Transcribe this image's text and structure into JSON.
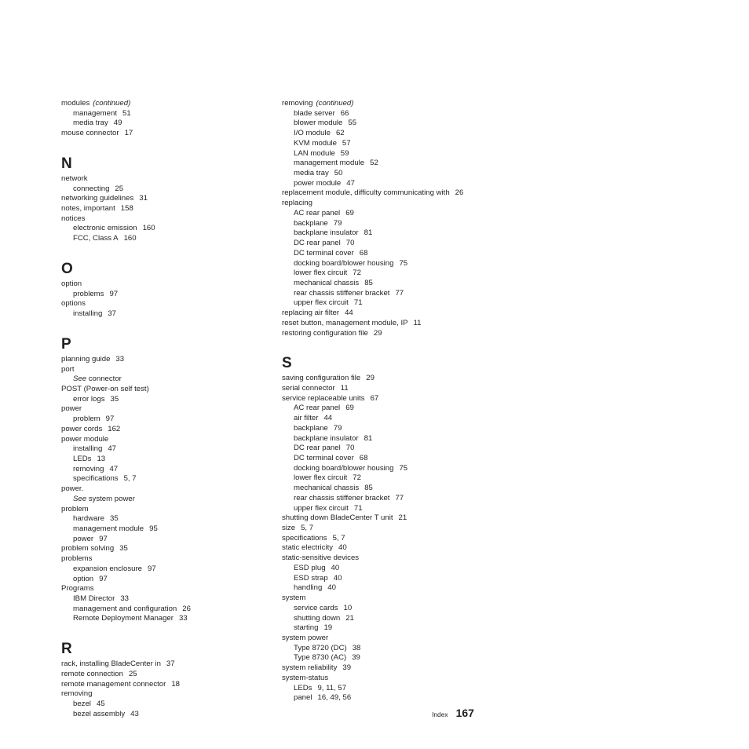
{
  "document": {
    "page_type": "index",
    "footer_label": "Index",
    "footer_page_number": "167",
    "text_color": "#231f20",
    "background_color": "#ffffff"
  },
  "columns": [
    {
      "name": "left-column",
      "sections": [
        {
          "letter": "",
          "entries": [
            {
              "level": 0,
              "term": "modules",
              "continued": "(continued)",
              "pages": ""
            },
            {
              "level": 1,
              "term": "management",
              "pages": "51"
            },
            {
              "level": 1,
              "term": "media tray",
              "pages": "49"
            },
            {
              "level": 0,
              "term": "mouse connector",
              "pages": "17"
            }
          ]
        },
        {
          "letter": "N",
          "entries": [
            {
              "level": 0,
              "term": "network",
              "pages": ""
            },
            {
              "level": 1,
              "term": "connecting",
              "pages": "25"
            },
            {
              "level": 0,
              "term": "networking guidelines",
              "pages": "31"
            },
            {
              "level": 0,
              "term": "notes, important",
              "pages": "158"
            },
            {
              "level": 0,
              "term": "notices",
              "pages": ""
            },
            {
              "level": 1,
              "term": "electronic emission",
              "pages": "160"
            },
            {
              "level": 1,
              "term": "FCC, Class A",
              "pages": "160"
            }
          ]
        },
        {
          "letter": "O",
          "entries": [
            {
              "level": 0,
              "term": "option",
              "pages": ""
            },
            {
              "level": 1,
              "term": "problems",
              "pages": "97"
            },
            {
              "level": 0,
              "term": "options",
              "pages": ""
            },
            {
              "level": 1,
              "term": "installing",
              "pages": "37"
            }
          ]
        },
        {
          "letter": "P",
          "entries": [
            {
              "level": 0,
              "term": "planning guide",
              "pages": "33"
            },
            {
              "level": 0,
              "term": "port",
              "pages": ""
            },
            {
              "level": 1,
              "see": "See",
              "term": "connector",
              "pages": ""
            },
            {
              "level": 0,
              "term": "POST (Power-on self test)",
              "pages": ""
            },
            {
              "level": 1,
              "term": "error logs",
              "pages": "35"
            },
            {
              "level": 0,
              "term": "power",
              "pages": ""
            },
            {
              "level": 1,
              "term": "problem",
              "pages": "97"
            },
            {
              "level": 0,
              "term": "power cords",
              "pages": "162"
            },
            {
              "level": 0,
              "term": "power module",
              "pages": ""
            },
            {
              "level": 1,
              "term": "installing",
              "pages": "47"
            },
            {
              "level": 1,
              "term": "LEDs",
              "pages": "13"
            },
            {
              "level": 1,
              "term": "removing",
              "pages": "47"
            },
            {
              "level": 1,
              "term": "specifications",
              "pages": "5, 7"
            },
            {
              "level": 0,
              "term": "power.",
              "pages": ""
            },
            {
              "level": 1,
              "see": "See",
              "term": "system power",
              "pages": ""
            },
            {
              "level": 0,
              "term": "problem",
              "pages": ""
            },
            {
              "level": 1,
              "term": "hardware",
              "pages": "35"
            },
            {
              "level": 1,
              "term": "management module",
              "pages": "95"
            },
            {
              "level": 1,
              "term": "power",
              "pages": "97"
            },
            {
              "level": 0,
              "term": "problem solving",
              "pages": "35"
            },
            {
              "level": 0,
              "term": "problems",
              "pages": ""
            },
            {
              "level": 1,
              "term": "expansion enclosure",
              "pages": "97"
            },
            {
              "level": 1,
              "term": "option",
              "pages": "97"
            },
            {
              "level": 0,
              "term": "Programs",
              "pages": ""
            },
            {
              "level": 1,
              "term": "IBM Director",
              "pages": "33"
            },
            {
              "level": 1,
              "term": "management and configuration",
              "pages": "26"
            },
            {
              "level": 1,
              "term": "Remote Deployment Manager",
              "pages": "33"
            }
          ]
        },
        {
          "letter": "R",
          "entries": [
            {
              "level": 0,
              "term": "rack, installing BladeCenter in",
              "pages": "37"
            },
            {
              "level": 0,
              "term": "remote connection",
              "pages": "25"
            },
            {
              "level": 0,
              "term": "remote management connector",
              "pages": "18"
            },
            {
              "level": 0,
              "term": "removing",
              "pages": ""
            },
            {
              "level": 1,
              "term": "bezel",
              "pages": "45"
            },
            {
              "level": 1,
              "term": "bezel assembly",
              "pages": "43"
            }
          ]
        }
      ]
    },
    {
      "name": "right-column",
      "sections": [
        {
          "letter": "",
          "entries": [
            {
              "level": 0,
              "term": "removing",
              "continued": "(continued)",
              "pages": ""
            },
            {
              "level": 1,
              "term": "blade server",
              "pages": "66"
            },
            {
              "level": 1,
              "term": "blower module",
              "pages": "55"
            },
            {
              "level": 1,
              "term": "I/O module",
              "pages": "62"
            },
            {
              "level": 1,
              "term": "KVM module",
              "pages": "57"
            },
            {
              "level": 1,
              "term": "LAN module",
              "pages": "59"
            },
            {
              "level": 1,
              "term": "management module",
              "pages": "52"
            },
            {
              "level": 1,
              "term": "media tray",
              "pages": "50"
            },
            {
              "level": 1,
              "term": "power module",
              "pages": "47"
            },
            {
              "level": 0,
              "term": "replacement module, difficulty communicating with",
              "pages": "26"
            },
            {
              "level": 0,
              "term": "replacing",
              "pages": ""
            },
            {
              "level": 1,
              "term": "AC rear panel",
              "pages": "69"
            },
            {
              "level": 1,
              "term": "backplane",
              "pages": "79"
            },
            {
              "level": 1,
              "term": "backplane insulator",
              "pages": "81"
            },
            {
              "level": 1,
              "term": "DC rear panel",
              "pages": "70"
            },
            {
              "level": 1,
              "term": "DC terminal cover",
              "pages": "68"
            },
            {
              "level": 1,
              "term": "docking board/blower housing",
              "pages": "75"
            },
            {
              "level": 1,
              "term": "lower flex circuit",
              "pages": "72"
            },
            {
              "level": 1,
              "term": "mechanical chassis",
              "pages": "85"
            },
            {
              "level": 1,
              "term": "rear chassis stiffener bracket",
              "pages": "77"
            },
            {
              "level": 1,
              "term": "upper flex circuit",
              "pages": "71"
            },
            {
              "level": 0,
              "term": "replacing air filter",
              "pages": "44"
            },
            {
              "level": 0,
              "term": "reset button, management module, IP",
              "pages": "11"
            },
            {
              "level": 0,
              "term": "restoring configuration file",
              "pages": "29"
            }
          ]
        },
        {
          "letter": "S",
          "entries": [
            {
              "level": 0,
              "term": "saving configuration file",
              "pages": "29"
            },
            {
              "level": 0,
              "term": "serial connector",
              "pages": "11"
            },
            {
              "level": 0,
              "term": "service replaceable units",
              "pages": "67"
            },
            {
              "level": 1,
              "term": "AC rear panel",
              "pages": "69"
            },
            {
              "level": 1,
              "term": "air filter",
              "pages": "44"
            },
            {
              "level": 1,
              "term": "backplane",
              "pages": "79"
            },
            {
              "level": 1,
              "term": "backplane insulator",
              "pages": "81"
            },
            {
              "level": 1,
              "term": "DC rear panel",
              "pages": "70"
            },
            {
              "level": 1,
              "term": "DC terminal cover",
              "pages": "68"
            },
            {
              "level": 1,
              "term": "docking board/blower housing",
              "pages": "75"
            },
            {
              "level": 1,
              "term": "lower flex circuit",
              "pages": "72"
            },
            {
              "level": 1,
              "term": "mechanical chassis",
              "pages": "85"
            },
            {
              "level": 1,
              "term": "rear chassis stiffener bracket",
              "pages": "77"
            },
            {
              "level": 1,
              "term": "upper flex circuit",
              "pages": "71"
            },
            {
              "level": 0,
              "term": "shutting down BladeCenter T unit",
              "pages": "21"
            },
            {
              "level": 0,
              "term": "size",
              "pages": "5, 7"
            },
            {
              "level": 0,
              "term": "specifications",
              "pages": "5, 7"
            },
            {
              "level": 0,
              "term": "static electricity",
              "pages": "40"
            },
            {
              "level": 0,
              "term": "static-sensitive devices",
              "pages": ""
            },
            {
              "level": 1,
              "term": "ESD plug",
              "pages": "40"
            },
            {
              "level": 1,
              "term": "ESD strap",
              "pages": "40"
            },
            {
              "level": 1,
              "term": "handling",
              "pages": "40"
            },
            {
              "level": 0,
              "term": "system",
              "pages": ""
            },
            {
              "level": 1,
              "term": "service cards",
              "pages": "10"
            },
            {
              "level": 1,
              "term": "shutting down",
              "pages": "21"
            },
            {
              "level": 1,
              "term": "starting",
              "pages": "19"
            },
            {
              "level": 0,
              "term": "system power",
              "pages": ""
            },
            {
              "level": 1,
              "term": "Type 8720 (DC)",
              "pages": "38"
            },
            {
              "level": 1,
              "term": "Type 8730 (AC)",
              "pages": "39"
            },
            {
              "level": 0,
              "term": "system reliability",
              "pages": "39"
            },
            {
              "level": 0,
              "term": "system-status",
              "pages": ""
            },
            {
              "level": 1,
              "term": "LEDs",
              "pages": "9, 11, 57"
            },
            {
              "level": 1,
              "term": "panel",
              "pages": "16, 49, 56"
            }
          ]
        }
      ]
    }
  ]
}
